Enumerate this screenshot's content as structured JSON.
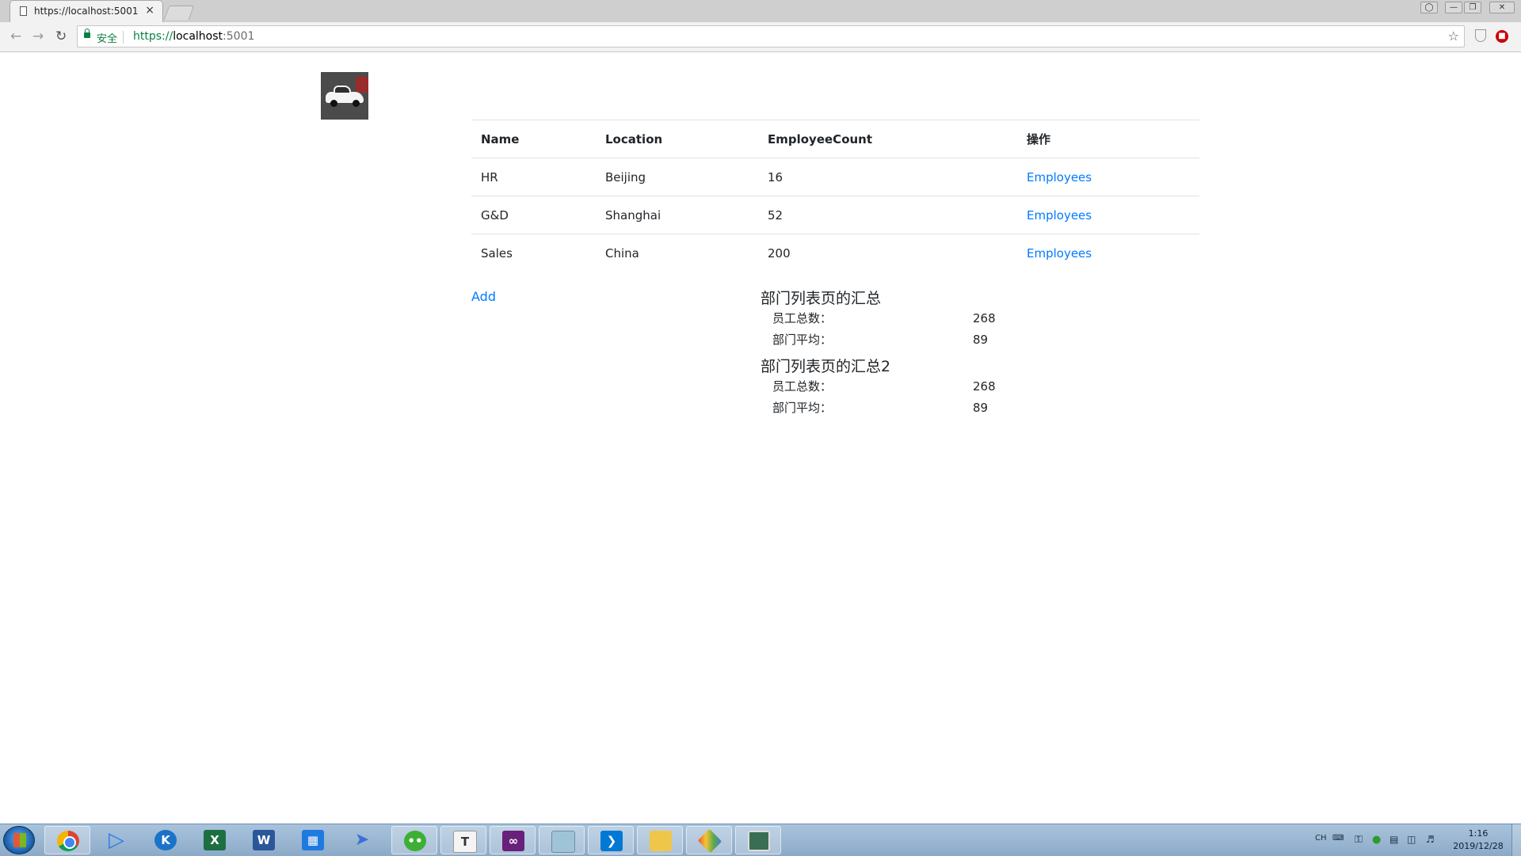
{
  "browser": {
    "tab_title": "https://localhost:5001",
    "tab_close": "×",
    "security_label": "安全",
    "url_scheme": "https://",
    "url_host": "localhost",
    "url_port": ":5001"
  },
  "table": {
    "headers": [
      "Name",
      "Location",
      "EmployeeCount",
      "操作"
    ],
    "rows": [
      {
        "name": "HR",
        "location": "Beijing",
        "count": "16",
        "action": "Employees"
      },
      {
        "name": "G&D",
        "location": "Shanghai",
        "count": "52",
        "action": "Employees"
      },
      {
        "name": "Sales",
        "location": "China",
        "count": "200",
        "action": "Employees"
      }
    ]
  },
  "add_link": "Add",
  "summary1": {
    "title": "部门列表页的汇总",
    "total_label": "员工总数：",
    "total_value": "268",
    "avg_label": "部门平均：",
    "avg_value": "89"
  },
  "summary2": {
    "title": "部门列表页的汇总2",
    "total_label": "员工总数：",
    "total_value": "268",
    "avg_label": "部门平均：",
    "avg_value": "89"
  },
  "taskbar": {
    "icons": [
      "chrome-icon",
      "media-player-icon",
      "k-app-icon",
      "excel-icon",
      "word-icon",
      "tiles-app-icon",
      "feather-app-icon",
      "wechat-icon",
      "text-editor-icon",
      "visual-studio-icon",
      "notepad-icon",
      "vscode-icon",
      "folder-icon",
      "git-icon",
      "terminal-window-icon"
    ],
    "tray_lang": "CH",
    "time": "1:16",
    "date": "2019/12/28"
  }
}
